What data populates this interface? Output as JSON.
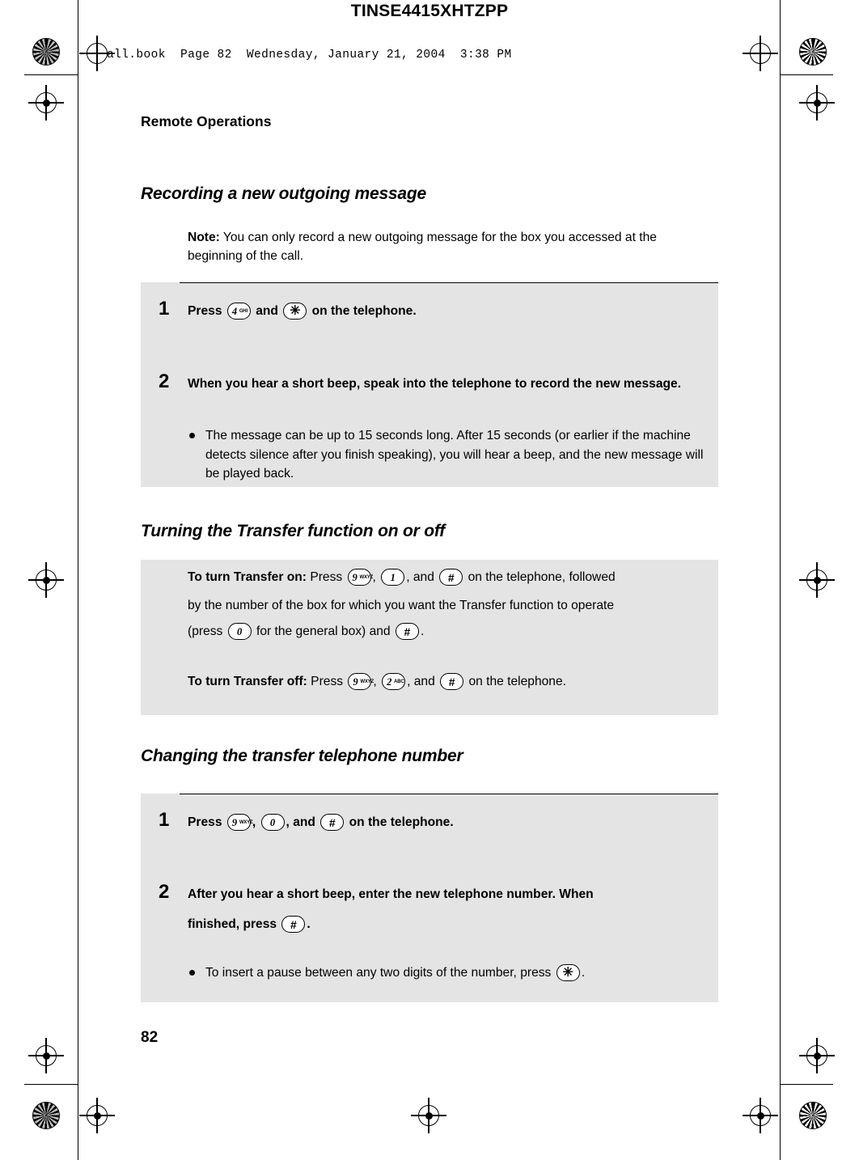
{
  "page": {
    "tinse_code": "TINSE4415XHTZPP",
    "file_stamp": "all.book  Page 82  Wednesday, January 21, 2004  3:38 PM",
    "running_head": "Remote Operations",
    "page_number": "82"
  },
  "sections": [
    {
      "heading": "Recording a new outgoing message",
      "note": {
        "label": "Note:",
        "text": " You can only record a new outgoing message for the box you accessed at the beginning of the call."
      },
      "steps": [
        {
          "num": "1",
          "pre": "Press",
          "mid": "and",
          "post": "on the telephone.",
          "keys": [
            "4GHI",
            "star"
          ]
        },
        {
          "num": "2",
          "text": "When you hear a short beep, speak into the telephone to record the new message.",
          "bullets": [
            "The message can be up to 15 seconds long. After 15 seconds (or earlier if the machine detects silence after you finish speaking), you will hear a beep, and the new message will be played back."
          ]
        }
      ]
    },
    {
      "heading": "Turning the Transfer function on or off",
      "paragraphs": [
        {
          "lead": "To turn Transfer on:",
          "t1": " Press",
          "t2": ",",
          "t3": ", and",
          "t4": "on the telephone, followed",
          "line2": "by the number of the box for which you want the Transfer function to operate",
          "line3a": "(press",
          "line3b": "for the general box) and",
          "line3c": "."
        },
        {
          "lead": "To turn Transfer off:",
          "t1": " Press",
          "t2": ",",
          "t3": ", and",
          "t4": "on the telephone."
        }
      ]
    },
    {
      "heading": "Changing the transfer telephone number",
      "steps": [
        {
          "num": "1",
          "pre": "Press",
          "sep1": ",",
          "sep2": ", and",
          "post": "on the telephone."
        },
        {
          "num": "2",
          "text": "After you hear a short beep, enter the new telephone number. When",
          "text2a": "finished, press",
          "text2b": ".",
          "bullets": [
            "To insert a pause between any two digits of the number, press"
          ],
          "bullet_tail": "."
        }
      ]
    }
  ],
  "keys": {
    "k4": {
      "big": "4",
      "small": "GHI"
    },
    "k9": {
      "big": "9",
      "small": "WXYZ"
    },
    "k2": {
      "big": "2",
      "small": "ABC"
    },
    "k1": {
      "big": "1",
      "small": ""
    },
    "k0": {
      "big": "0",
      "small": ""
    },
    "star": "✳",
    "hash": "#"
  },
  "colors": {
    "page_background": "#ffffff",
    "shaded_block": "#e4e4e4",
    "text": "#000000"
  }
}
